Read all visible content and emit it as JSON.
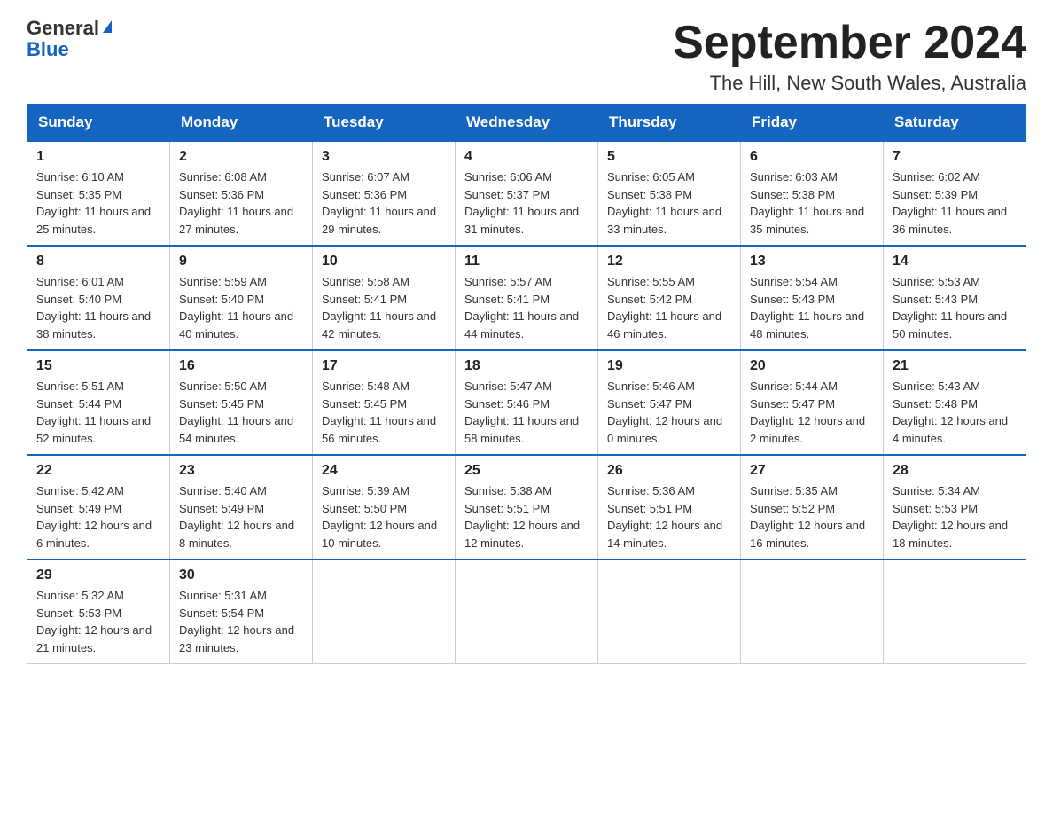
{
  "logo": {
    "general": "General",
    "blue": "Blue"
  },
  "title": "September 2024",
  "location": "The Hill, New South Wales, Australia",
  "days_of_week": [
    "Sunday",
    "Monday",
    "Tuesday",
    "Wednesday",
    "Thursday",
    "Friday",
    "Saturday"
  ],
  "weeks": [
    [
      {
        "day": "1",
        "sunrise": "6:10 AM",
        "sunset": "5:35 PM",
        "daylight": "11 hours and 25 minutes."
      },
      {
        "day": "2",
        "sunrise": "6:08 AM",
        "sunset": "5:36 PM",
        "daylight": "11 hours and 27 minutes."
      },
      {
        "day": "3",
        "sunrise": "6:07 AM",
        "sunset": "5:36 PM",
        "daylight": "11 hours and 29 minutes."
      },
      {
        "day": "4",
        "sunrise": "6:06 AM",
        "sunset": "5:37 PM",
        "daylight": "11 hours and 31 minutes."
      },
      {
        "day": "5",
        "sunrise": "6:05 AM",
        "sunset": "5:38 PM",
        "daylight": "11 hours and 33 minutes."
      },
      {
        "day": "6",
        "sunrise": "6:03 AM",
        "sunset": "5:38 PM",
        "daylight": "11 hours and 35 minutes."
      },
      {
        "day": "7",
        "sunrise": "6:02 AM",
        "sunset": "5:39 PM",
        "daylight": "11 hours and 36 minutes."
      }
    ],
    [
      {
        "day": "8",
        "sunrise": "6:01 AM",
        "sunset": "5:40 PM",
        "daylight": "11 hours and 38 minutes."
      },
      {
        "day": "9",
        "sunrise": "5:59 AM",
        "sunset": "5:40 PM",
        "daylight": "11 hours and 40 minutes."
      },
      {
        "day": "10",
        "sunrise": "5:58 AM",
        "sunset": "5:41 PM",
        "daylight": "11 hours and 42 minutes."
      },
      {
        "day": "11",
        "sunrise": "5:57 AM",
        "sunset": "5:41 PM",
        "daylight": "11 hours and 44 minutes."
      },
      {
        "day": "12",
        "sunrise": "5:55 AM",
        "sunset": "5:42 PM",
        "daylight": "11 hours and 46 minutes."
      },
      {
        "day": "13",
        "sunrise": "5:54 AM",
        "sunset": "5:43 PM",
        "daylight": "11 hours and 48 minutes."
      },
      {
        "day": "14",
        "sunrise": "5:53 AM",
        "sunset": "5:43 PM",
        "daylight": "11 hours and 50 minutes."
      }
    ],
    [
      {
        "day": "15",
        "sunrise": "5:51 AM",
        "sunset": "5:44 PM",
        "daylight": "11 hours and 52 minutes."
      },
      {
        "day": "16",
        "sunrise": "5:50 AM",
        "sunset": "5:45 PM",
        "daylight": "11 hours and 54 minutes."
      },
      {
        "day": "17",
        "sunrise": "5:48 AM",
        "sunset": "5:45 PM",
        "daylight": "11 hours and 56 minutes."
      },
      {
        "day": "18",
        "sunrise": "5:47 AM",
        "sunset": "5:46 PM",
        "daylight": "11 hours and 58 minutes."
      },
      {
        "day": "19",
        "sunrise": "5:46 AM",
        "sunset": "5:47 PM",
        "daylight": "12 hours and 0 minutes."
      },
      {
        "day": "20",
        "sunrise": "5:44 AM",
        "sunset": "5:47 PM",
        "daylight": "12 hours and 2 minutes."
      },
      {
        "day": "21",
        "sunrise": "5:43 AM",
        "sunset": "5:48 PM",
        "daylight": "12 hours and 4 minutes."
      }
    ],
    [
      {
        "day": "22",
        "sunrise": "5:42 AM",
        "sunset": "5:49 PM",
        "daylight": "12 hours and 6 minutes."
      },
      {
        "day": "23",
        "sunrise": "5:40 AM",
        "sunset": "5:49 PM",
        "daylight": "12 hours and 8 minutes."
      },
      {
        "day": "24",
        "sunrise": "5:39 AM",
        "sunset": "5:50 PM",
        "daylight": "12 hours and 10 minutes."
      },
      {
        "day": "25",
        "sunrise": "5:38 AM",
        "sunset": "5:51 PM",
        "daylight": "12 hours and 12 minutes."
      },
      {
        "day": "26",
        "sunrise": "5:36 AM",
        "sunset": "5:51 PM",
        "daylight": "12 hours and 14 minutes."
      },
      {
        "day": "27",
        "sunrise": "5:35 AM",
        "sunset": "5:52 PM",
        "daylight": "12 hours and 16 minutes."
      },
      {
        "day": "28",
        "sunrise": "5:34 AM",
        "sunset": "5:53 PM",
        "daylight": "12 hours and 18 minutes."
      }
    ],
    [
      {
        "day": "29",
        "sunrise": "5:32 AM",
        "sunset": "5:53 PM",
        "daylight": "12 hours and 21 minutes."
      },
      {
        "day": "30",
        "sunrise": "5:31 AM",
        "sunset": "5:54 PM",
        "daylight": "12 hours and 23 minutes."
      },
      null,
      null,
      null,
      null,
      null
    ]
  ]
}
